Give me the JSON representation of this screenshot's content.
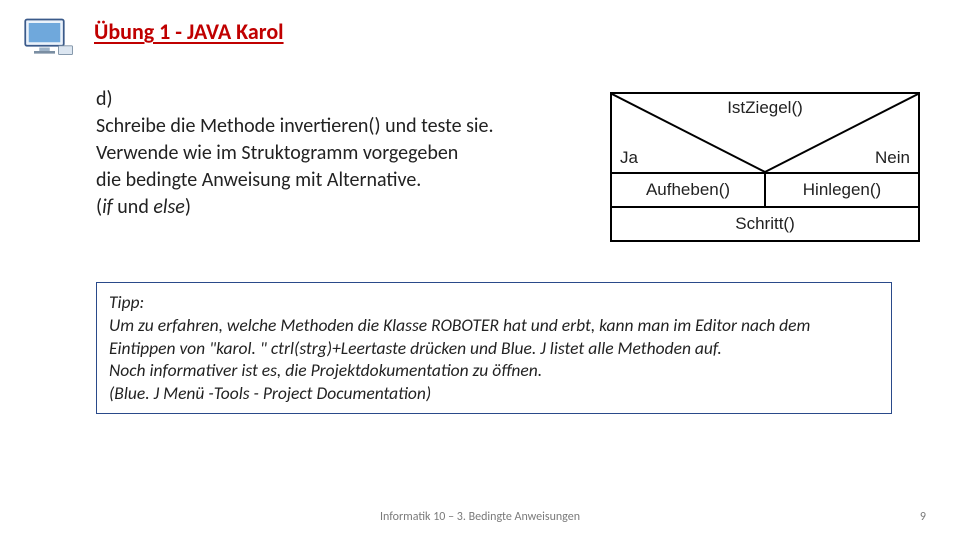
{
  "header": {
    "title": "Übung 1 - JAVA Karol",
    "icon": "computer-monitor-icon"
  },
  "task": {
    "label": "d)",
    "line1": "Schreibe die Methode invertieren() und teste sie.",
    "line2": "Verwende wie im Struktogramm vorgegeben",
    "line3": " die bedingte Anweisung mit Alternative.",
    "line4_prefix": " (",
    "line4_if": "if",
    "line4_mid": " und ",
    "line4_else": "else",
    "line4_suffix": ")"
  },
  "struktogramm": {
    "condition": "IstZiegel()",
    "yes_label": "Ja",
    "no_label": "Nein",
    "yes_action": "Aufheben()",
    "no_action": "Hinlegen()",
    "after_action": "Schritt()"
  },
  "tip": {
    "heading": "Tipp:",
    "p1": "Um zu erfahren, welche Methoden die Klasse ROBOTER hat und erbt, kann man im Editor nach dem Eintippen von \"karol. \"  ctrl(strg)+Leertaste drücken und Blue. J listet alle Methoden auf.",
    "p2": "Noch informativer ist es, die Projektdokumentation zu öffnen.",
    "p3": "(Blue. J Menü -Tools - Project Documentation)"
  },
  "footer": {
    "text": "Informatik 10 – 3. Bedingte Anweisungen",
    "page": "9"
  }
}
